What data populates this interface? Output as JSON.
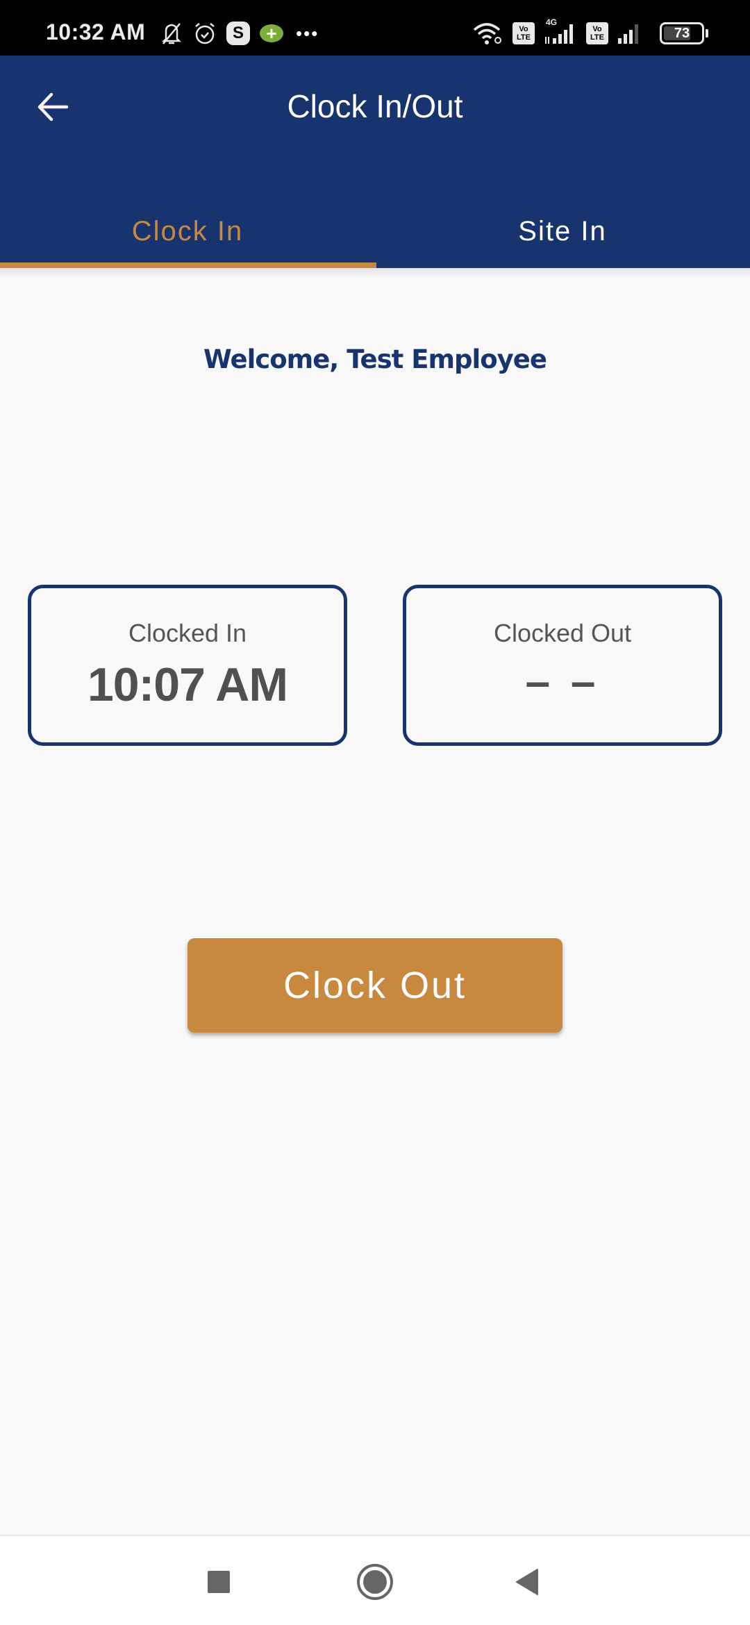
{
  "status_bar": {
    "time": "10:32 AM",
    "left_icons": [
      "bell-muted-icon",
      "alarm-icon",
      "skype-icon",
      "google-plus-icon",
      "more-dots-icon"
    ],
    "skype_glyph": "S",
    "gplus_glyph": "+",
    "more_glyph": "•••",
    "network_label": "4G",
    "volte_label_top": "Vo",
    "volte_label_bottom": "LTE",
    "battery_level": "73",
    "battery_percent": 73
  },
  "app_bar": {
    "title": "Clock In/Out",
    "back_icon": "arrow-left-icon",
    "background_color": "#17346f"
  },
  "tabs": [
    {
      "label": "Clock In",
      "active": true
    },
    {
      "label": "Site In",
      "active": false
    }
  ],
  "accent_color": "#c8893e",
  "main": {
    "welcome_text": "Welcome, Test Employee",
    "cards": {
      "clocked_in": {
        "label": "Clocked In",
        "value": "10:07 AM"
      },
      "clocked_out": {
        "label": "Clocked Out",
        "value": "– –"
      }
    },
    "clock_out_button_label": "Clock Out"
  },
  "nav_bar": {
    "buttons": [
      "recents-icon",
      "home-icon",
      "back-icon"
    ]
  }
}
